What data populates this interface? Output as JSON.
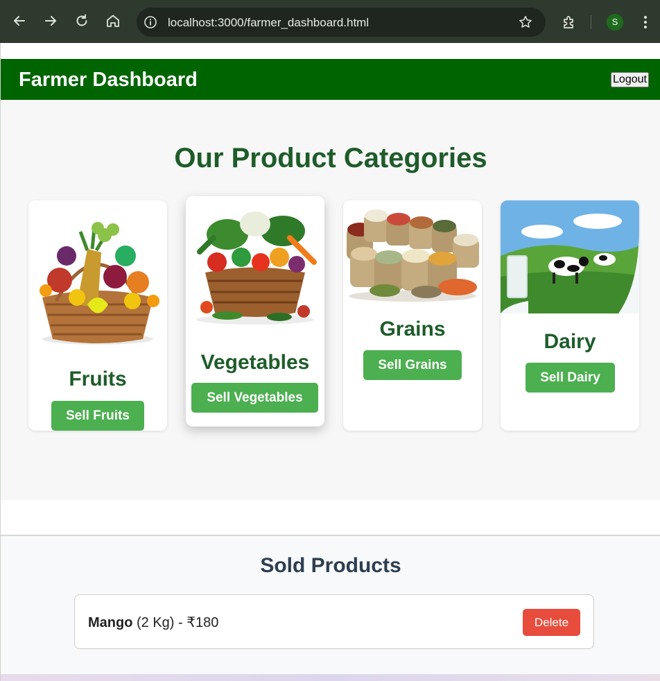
{
  "browser": {
    "url": "localhost:3000/farmer_dashboard.html",
    "profile_initial": "S",
    "icons": [
      "back-icon",
      "forward-icon",
      "reload-icon",
      "home-icon",
      "info-icon",
      "star-icon",
      "extensions-icon",
      "menu-icon"
    ]
  },
  "header": {
    "title": "Farmer Dashboard",
    "logout_label": "Logout",
    "background": "#006400"
  },
  "categories": {
    "heading": "Our Product Categories",
    "items": [
      {
        "name": "Fruits",
        "button": "Sell Fruits",
        "image": "fruit-basket"
      },
      {
        "name": "Vegetables",
        "button": "Sell Vegetables",
        "image": "vegetable-basket"
      },
      {
        "name": "Grains",
        "button": "Sell Grains",
        "image": "grain-sacks"
      },
      {
        "name": "Dairy",
        "button": "Sell Dairy",
        "image": "cows-in-meadow-with-milk"
      }
    ],
    "accent": "#4caf50",
    "heading_color": "#1e5c2a"
  },
  "sold": {
    "heading": "Sold Products",
    "items": [
      {
        "product": "Mango",
        "quantity": "(2 Kg)",
        "separator": "-",
        "price": "₹180",
        "delete_label": "Delete"
      }
    ],
    "delete_color": "#e74c3c"
  }
}
